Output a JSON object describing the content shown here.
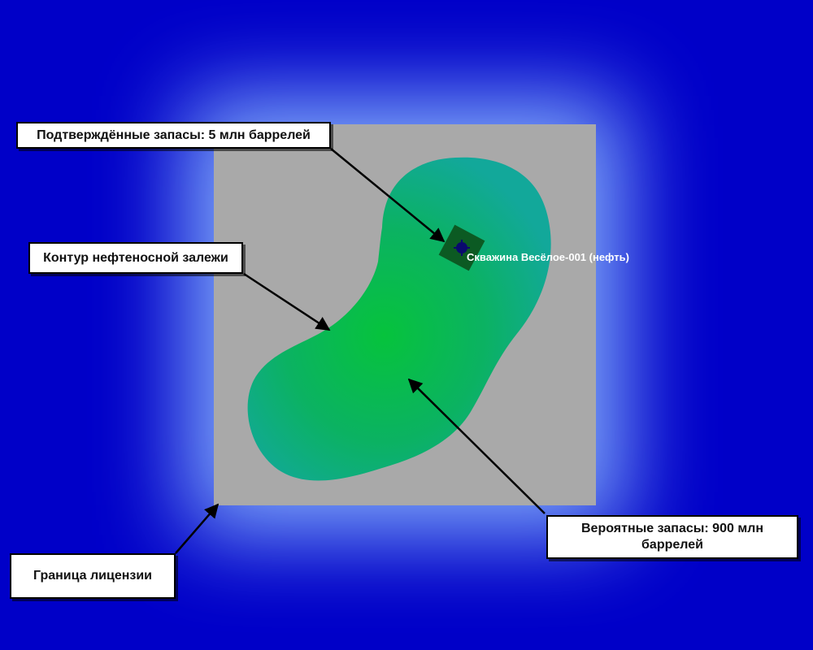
{
  "map": {
    "colors": {
      "ocean": "#0000c8",
      "license_area": "#a9a9a9",
      "oil_field_edge": "#12a89a",
      "oil_field_core": "#06c33c",
      "well_pad": "#0c5a23",
      "well_marker": "#0a0a6e"
    },
    "well": {
      "label": "Скважина Весёлое-001 (нефть)",
      "icon": "well-crosshair-icon"
    },
    "callouts": {
      "proven": "Подтверждённые запасы: 5 млн баррелей",
      "contour": "Контур нефтеносной залежи",
      "probable": "Вероятные запасы: 900 млн баррелей",
      "license": "Граница лицензии"
    }
  }
}
